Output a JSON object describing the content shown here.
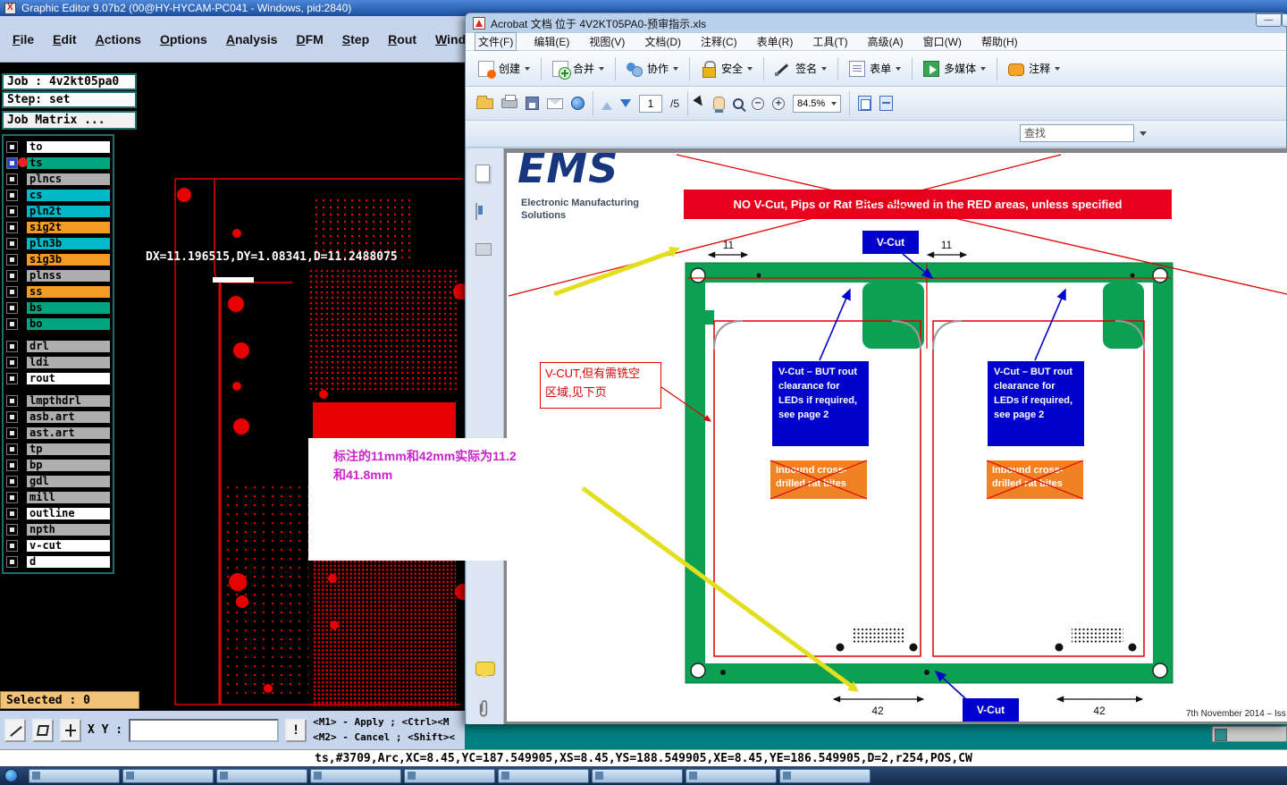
{
  "colors": {
    "accent_blue": "#0000cc",
    "panel_green": "#0ba052",
    "artwork_red": "#e60000",
    "banner_red": "#e8001c",
    "rat_bite_orange": "#f08224",
    "note_magenta": "#cc22cc",
    "selected_bar_orange": "#f2c377",
    "desktop_teal": "#007f80"
  },
  "graphic_editor": {
    "title": "Graphic Editor 9.07b2 (00@HY-HYCAM-PC041 - Windows, pid:2840)",
    "menus": [
      "File",
      "Edit",
      "Actions",
      "Options",
      "Analysis",
      "DFM",
      "Step",
      "Rout",
      "Windows"
    ],
    "job_label": "Job : 4v2kt05pa0",
    "step_label": "Step: set",
    "job_matrix_label": "Job Matrix ...",
    "active_layer": "ts",
    "layers": [
      {
        "name": "to",
        "color": "#ffffff"
      },
      {
        "name": "ts",
        "color": "#00a47e"
      },
      {
        "name": "plncs",
        "color": "#aeaeae"
      },
      {
        "name": "cs",
        "color": "#00b8c8"
      },
      {
        "name": "pln2t",
        "color": "#00b8c8"
      },
      {
        "name": "sig2t",
        "color": "#f59a23"
      },
      {
        "name": "pln3b",
        "color": "#00b8c8"
      },
      {
        "name": "sig3b",
        "color": "#f59a23"
      },
      {
        "name": "plnss",
        "color": "#aeaeae"
      },
      {
        "name": "ss",
        "color": "#f59a23"
      },
      {
        "name": "bs",
        "color": "#00a47e"
      },
      {
        "name": "bo",
        "color": "#00a47e"
      },
      {
        "name": "drl",
        "color": "#aeaeae"
      },
      {
        "name": "ldi",
        "color": "#aeaeae"
      },
      {
        "name": "rout",
        "color": "#ffffff"
      },
      {
        "name": "lmpthdrl",
        "color": "#aeaeae"
      },
      {
        "name": "asb.art",
        "color": "#aeaeae"
      },
      {
        "name": "ast.art",
        "color": "#aeaeae"
      },
      {
        "name": "tp",
        "color": "#aeaeae"
      },
      {
        "name": "bp",
        "color": "#aeaeae"
      },
      {
        "name": "gdl",
        "color": "#aeaeae"
      },
      {
        "name": "mill",
        "color": "#aeaeae"
      },
      {
        "name": "outline",
        "color": "#ffffff"
      },
      {
        "name": "npth",
        "color": "#aeaeae"
      },
      {
        "name": "v-cut",
        "color": "#ffffff"
      },
      {
        "name": "d",
        "color": "#ffffff"
      }
    ],
    "canvas_readout": "DX=11.196515,DY=1.08341,D=11.2488075",
    "note_line1": "标注的11mm和42mm实际为11.2",
    "note_line2": "和41.8mm",
    "selected_label": "Selected : 0",
    "xy_label": "X Y :",
    "xy_value": "",
    "alert_button": "!",
    "hint_line1": "<M1> - Apply ; <Ctrl><M",
    "hint_line2": "<M2> - Cancel ; <Shift><",
    "status_text": "ts,#3709,Arc,XC=8.45,YC=187.549905,XS=8.45,YS=188.549905,XE=8.45,YE=186.549905,D=2,r254,POS,CW"
  },
  "acrobat": {
    "title": "Acrobat 文档 位于 4V2KT05PA0-预审指示.xls",
    "menus": [
      "文件(F)",
      "编辑(E)",
      "视图(V)",
      "文档(D)",
      "注释(C)",
      "表单(R)",
      "工具(T)",
      "高级(A)",
      "窗口(W)",
      "帮助(H)"
    ],
    "toolbar_items": [
      {
        "label": "创建",
        "icon": "create"
      },
      {
        "label": "合并",
        "icon": "combine"
      },
      {
        "label": "协作",
        "icon": "collaborate"
      },
      {
        "label": "安全",
        "icon": "secure"
      },
      {
        "label": "签名",
        "icon": "sign"
      },
      {
        "label": "表单",
        "icon": "forms"
      },
      {
        "label": "多媒体",
        "icon": "multimedia"
      },
      {
        "label": "注释",
        "icon": "comment"
      }
    ],
    "page_current": "1",
    "page_total": "/5",
    "zoom_level": "84.5%",
    "find_placeholder": "查找",
    "pdf": {
      "logo_text": "EMS",
      "logo_tagline1": "Electronic Manufacturing",
      "logo_tagline2": "Solutions",
      "banner": "NO V-Cut, Pips or Rat Bites allowed in the RED areas, unless specified",
      "vcut_top": "V-Cut",
      "vcut_bottom": "V-Cut",
      "led_note": "V-Cut – BUT rout clearance for LEDs if required, see page 2",
      "rat_bite_note": "Inbound cross-drilled rat bites",
      "red_note_line1": "V-CUT,但有需铣空",
      "red_note_line2": "区域,见下页",
      "dim_top_left": "11",
      "dim_top_right": "11",
      "dim_bottom_left": "42",
      "dim_bottom_right": "42",
      "date_text": "7th November 2014 – Iss"
    }
  },
  "taskbar": {
    "button_count": 9
  }
}
